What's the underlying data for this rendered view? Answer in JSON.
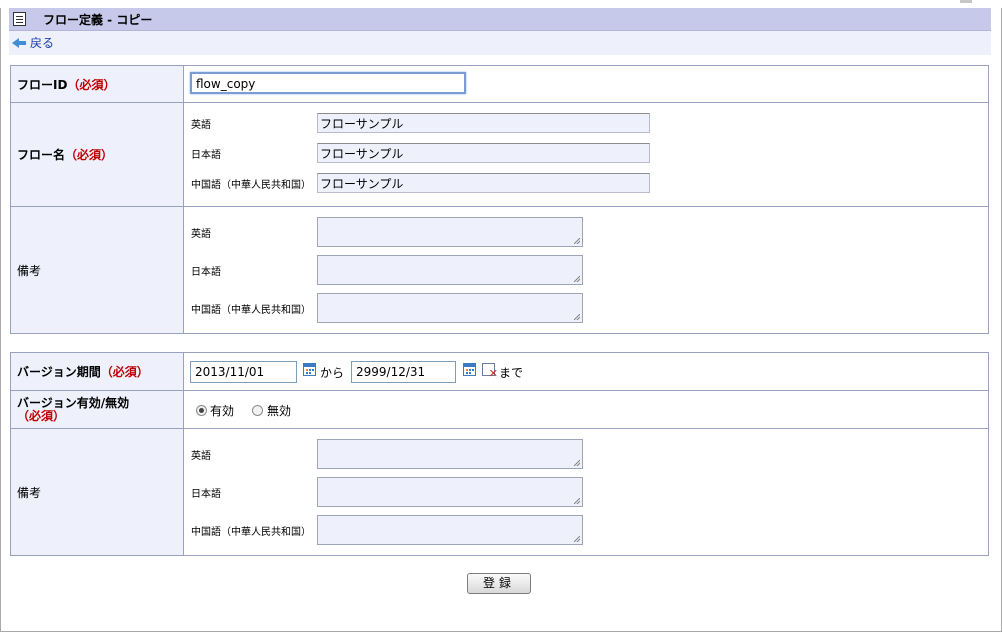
{
  "header": {
    "title": "フロー定義 - コピー",
    "back_label": "戻る"
  },
  "section1": {
    "flow_id": {
      "label": "フローID",
      "required": "（必須）",
      "value": "flow_copy"
    },
    "flow_name": {
      "label": "フロー名",
      "required": "（必須）",
      "langs": [
        {
          "lang": "英語",
          "value": "フローサンプル"
        },
        {
          "lang": "日本語",
          "value": "フローサンプル"
        },
        {
          "lang": "中国語（中華人民共和国）",
          "value": "フローサンプル"
        }
      ]
    },
    "remarks": {
      "label": "備考",
      "langs": [
        {
          "lang": "英語",
          "value": ""
        },
        {
          "lang": "日本語",
          "value": ""
        },
        {
          "lang": "中国語（中華人民共和国）",
          "value": ""
        }
      ]
    }
  },
  "section2": {
    "period": {
      "label": "バージョン期間",
      "required": "（必須）",
      "start": "2013/11/01",
      "from_text": "から",
      "end": "2999/12/31",
      "until_text": "まで"
    },
    "enabled": {
      "label": "バージョン有効/無効",
      "required": "（必須）",
      "options": [
        "有効",
        "無効"
      ],
      "selected": "有効"
    },
    "remarks": {
      "label": "備考",
      "langs": [
        {
          "lang": "英語",
          "value": ""
        },
        {
          "lang": "日本語",
          "value": ""
        },
        {
          "lang": "中国語（中華人民共和国）",
          "value": ""
        }
      ]
    }
  },
  "register_label": "登録"
}
